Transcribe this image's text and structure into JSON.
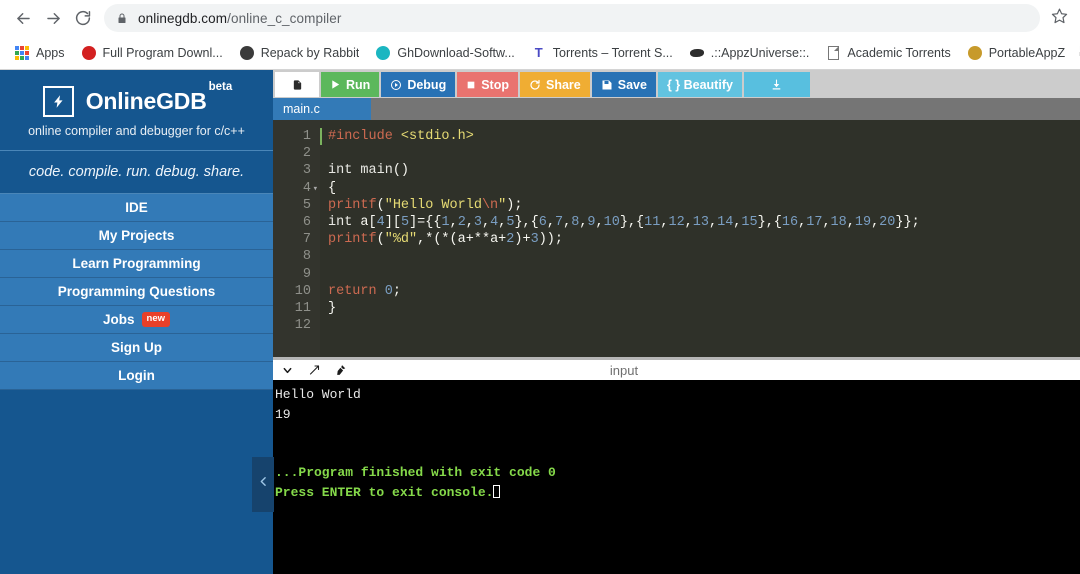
{
  "browser": {
    "back_icon": "back-arrow-icon",
    "forward_icon": "forward-arrow-icon",
    "reload_icon": "reload-icon",
    "lock_icon": "lock-icon",
    "url_host": "onlinegdb.com",
    "url_path": "/online_c_compiler",
    "url_full": "onlinegdb.com/online_c_compiler",
    "star_icon": "bookmark-star-icon",
    "bookmarks": [
      {
        "label": "Apps",
        "icon": "apps-grid-icon"
      },
      {
        "label": "Full Program Downl...",
        "icon": "red-circle-favicon"
      },
      {
        "label": "Repack by Rabbit",
        "icon": "globe-favicon"
      },
      {
        "label": "GhDownload-Softw...",
        "icon": "teal-circle-favicon"
      },
      {
        "label": "Torrents – Torrent S...",
        "icon": "torrent-t-favicon"
      },
      {
        "label": ".::AppzUniverse::.",
        "icon": "dark-shape-favicon"
      },
      {
        "label": "Academic Torrents",
        "icon": "document-favicon"
      },
      {
        "label": "PortableAppZ",
        "icon": "gold-circle-favicon"
      },
      {
        "label": "",
        "icon": "fablab-favicon"
      }
    ]
  },
  "sidebar": {
    "logo_icon": "lightning-bolt-icon",
    "brand_name": "OnlineGDB",
    "brand_beta": "beta",
    "brand_tagline": "online compiler and debugger for c/c++",
    "slogan": "code. compile. run. debug. share.",
    "items": [
      {
        "label": "IDE",
        "badge": ""
      },
      {
        "label": "My Projects",
        "badge": ""
      },
      {
        "label": "Learn Programming",
        "badge": ""
      },
      {
        "label": "Programming Questions",
        "badge": ""
      },
      {
        "label": "Jobs",
        "badge": "new"
      },
      {
        "label": "Sign Up",
        "badge": ""
      },
      {
        "label": "Login",
        "badge": ""
      }
    ]
  },
  "toolbar": {
    "new_file_icon": "new-file-icon",
    "run_label": "Run",
    "run_icon": "play-icon",
    "debug_label": "Debug",
    "debug_icon": "debug-circle-icon",
    "stop_label": "Stop",
    "stop_icon": "stop-square-icon",
    "share_label": "Share",
    "share_icon": "share-icon",
    "save_label": "Save",
    "save_icon": "floppy-disk-icon",
    "beautify_label": "{ } Beautify",
    "download_icon": "download-icon"
  },
  "tabs": [
    {
      "label": "main.c",
      "active": true
    }
  ],
  "editor": {
    "line_numbers": [
      "1",
      "2",
      "3",
      "4",
      "5",
      "6",
      "7",
      "8",
      "9",
      "10",
      "11",
      "12"
    ],
    "fold_marker_line": 4,
    "code_plain": [
      "#include <stdio.h>",
      "",
      "int main()",
      "{",
      "    printf(\"Hello World\\n\");",
      "    int a[4][5]={{1,2,3,4,5},{6,7,8,9,10},{11,12,13,14,15},{16,17,18,19,20}};",
      "printf(\"%d\",*(*(a+**a+2)+3));",
      "",
      "",
      "    return 0;",
      "}",
      ""
    ]
  },
  "console": {
    "collapse_icon": "chevron-down-icon",
    "expand_icon": "expand-arrows-icon",
    "clear_icon": "clear-console-icon",
    "input_placeholder": "input",
    "lines": [
      {
        "text": "Hello World",
        "style": "white"
      },
      {
        "text": "19",
        "style": "white"
      },
      {
        "text": "",
        "style": "white"
      },
      {
        "text": "",
        "style": "white"
      },
      {
        "text": "...Program finished with exit code 0",
        "style": "green"
      },
      {
        "text": "Press ENTER to exit console.",
        "style": "green",
        "caret": true
      }
    ]
  },
  "collapse_handle": {
    "icon": "chevron-left-icon"
  },
  "colors": {
    "sidebar_bg": "#15568f",
    "nav_item_bg": "#337ab7",
    "run_green": "#5cb85c",
    "debug_blue": "#2872b5",
    "stop_red": "#e9736f",
    "share_orange": "#f0ad33",
    "beautify_cyan": "#62c3e0",
    "download_cyan": "#58bfdf",
    "editor_bg": "#2f3129",
    "gutter_bg": "#33342d",
    "console_bg": "#000000",
    "console_green": "#85d94a",
    "badge_red": "#e8402a"
  }
}
